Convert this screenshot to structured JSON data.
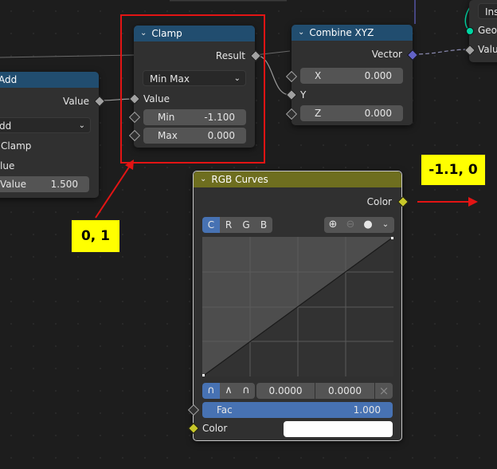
{
  "nodes": {
    "add": {
      "title": "Add",
      "output": "Value",
      "operation": "dd",
      "clamp_label": "Clamp",
      "input_label": "lue",
      "value_field": {
        "label": "Value",
        "value": "1.500"
      }
    },
    "clamp": {
      "title": "Clamp",
      "output": "Result",
      "mode": "Min Max",
      "input": "Value",
      "min": {
        "label": "Min",
        "value": "-1.100"
      },
      "max": {
        "label": "Max",
        "value": "0.000"
      }
    },
    "combine_xyz": {
      "title": "Combine XYZ",
      "output": "Vector",
      "x": {
        "label": "X",
        "value": "0.000"
      },
      "y_label": "Y",
      "z": {
        "label": "Z",
        "value": "0.000"
      }
    },
    "partial_right": {
      "top_text": "Ins",
      "geo_label": "Geo",
      "value_label": "Valu"
    },
    "rgb_curves": {
      "title": "RGB Curves",
      "output": "Color",
      "channels": [
        "C",
        "R",
        "G",
        "B"
      ],
      "active_channel": "C",
      "icons": [
        "zoom-in-icon",
        "zoom-out-icon",
        "clip-dot-icon",
        "chevron-down-icon"
      ],
      "handle_icons": [
        "auto-handle-icon",
        "vector-handle-icon",
        "auto-clamped-handle-icon"
      ],
      "point_x": "0.0000",
      "point_y": "0.0000",
      "delete_icon": "×",
      "fac": {
        "label": "Fac",
        "value": "1.000"
      },
      "color_input": "Color",
      "color_value": "#ffffff"
    }
  },
  "annotations": {
    "left_note": "0, 1",
    "right_note": "-1.1, 0"
  },
  "colors": {
    "header_blue": "#214d6f",
    "header_olive": "#6e6e1f",
    "annotation_red": "#e31414",
    "annotation_yellow": "#ffff00",
    "accent_blue": "#4772b3"
  }
}
